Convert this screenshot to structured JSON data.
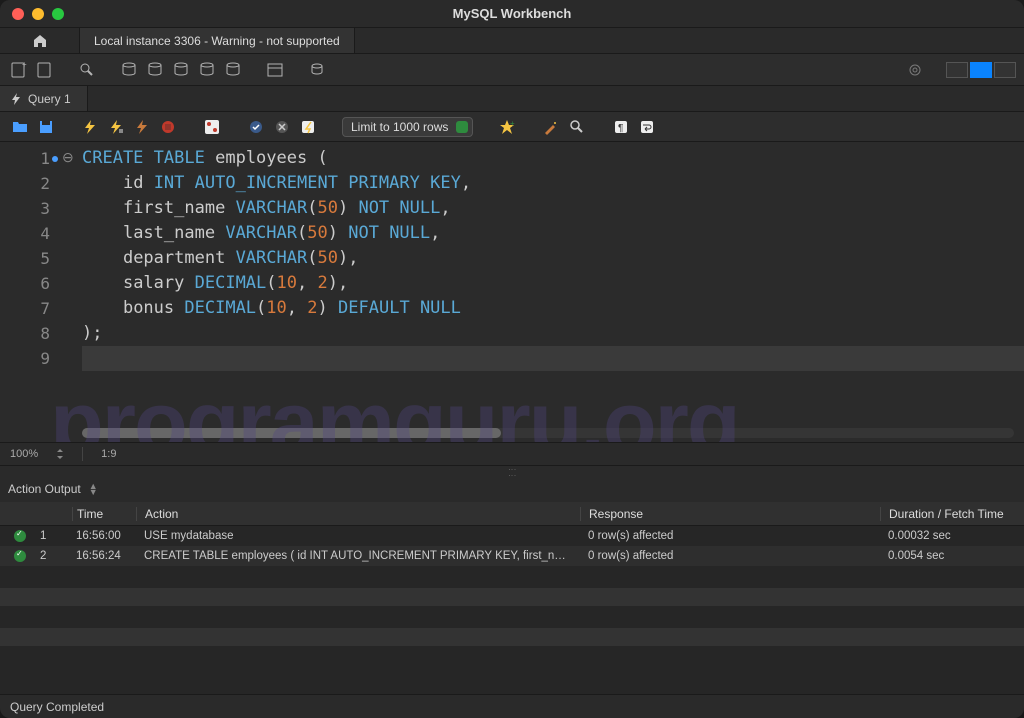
{
  "app_title": "MySQL Workbench",
  "connection_tab": "Local instance 3306 - Warning - not supported",
  "query_tab": "Query 1",
  "limit_label": "Limit to 1000 rows",
  "editor": {
    "lines": [
      {
        "n": "1",
        "html": "<span class='kw'>CREATE</span> <span class='kw'>TABLE</span> <span class='ident'>employees</span> <span class='paren'>(</span>"
      },
      {
        "n": "2",
        "html": "    <span class='ident'>id</span> <span class='kw'>INT</span> <span class='kw'>AUTO_INCREMENT</span> <span class='kw'>PRIMARY</span> <span class='kw'>KEY</span><span class='paren'>,</span>"
      },
      {
        "n": "3",
        "html": "    <span class='ident'>first_name</span> <span class='kw'>VARCHAR</span><span class='paren'>(</span><span class='num'>50</span><span class='paren'>)</span> <span class='kw'>NOT</span> <span class='kw'>NULL</span><span class='paren'>,</span>"
      },
      {
        "n": "4",
        "html": "    <span class='ident'>last_name</span> <span class='kw'>VARCHAR</span><span class='paren'>(</span><span class='num'>50</span><span class='paren'>)</span> <span class='kw'>NOT</span> <span class='kw'>NULL</span><span class='paren'>,</span>"
      },
      {
        "n": "5",
        "html": "    <span class='ident'>department</span> <span class='kw'>VARCHAR</span><span class='paren'>(</span><span class='num'>50</span><span class='paren'>)</span><span class='paren'>,</span>"
      },
      {
        "n": "6",
        "html": "    <span class='ident'>salary</span> <span class='kw'>DECIMAL</span><span class='paren'>(</span><span class='num'>10</span><span class='paren'>,</span> <span class='num'>2</span><span class='paren'>)</span><span class='paren'>,</span>"
      },
      {
        "n": "7",
        "html": "    <span class='ident'>bonus</span> <span class='kw'>DECIMAL</span><span class='paren'>(</span><span class='num'>10</span><span class='paren'>,</span> <span class='num'>2</span><span class='paren'>)</span> <span class='kw'>DEFAULT</span> <span class='kw'>NULL</span>"
      },
      {
        "n": "8",
        "html": "<span class='paren'>);</span>"
      },
      {
        "n": "9",
        "html": ""
      }
    ]
  },
  "status": {
    "zoom": "100%",
    "pos": "1:9"
  },
  "watermark": "programguru.org",
  "output_label": "Action Output",
  "output_columns": {
    "time": "Time",
    "action": "Action",
    "response": "Response",
    "duration": "Duration / Fetch Time"
  },
  "output_rows": [
    {
      "num": "1",
      "time": "16:56:00",
      "action": "USE mydatabase",
      "response": "0 row(s) affected",
      "duration": "0.00032 sec"
    },
    {
      "num": "2",
      "time": "16:56:24",
      "action": "CREATE TABLE employees (     id INT AUTO_INCREMENT PRIMARY KEY,     first_n…",
      "response": "0 row(s) affected",
      "duration": "0.0054 sec"
    }
  ],
  "footer": "Query Completed"
}
